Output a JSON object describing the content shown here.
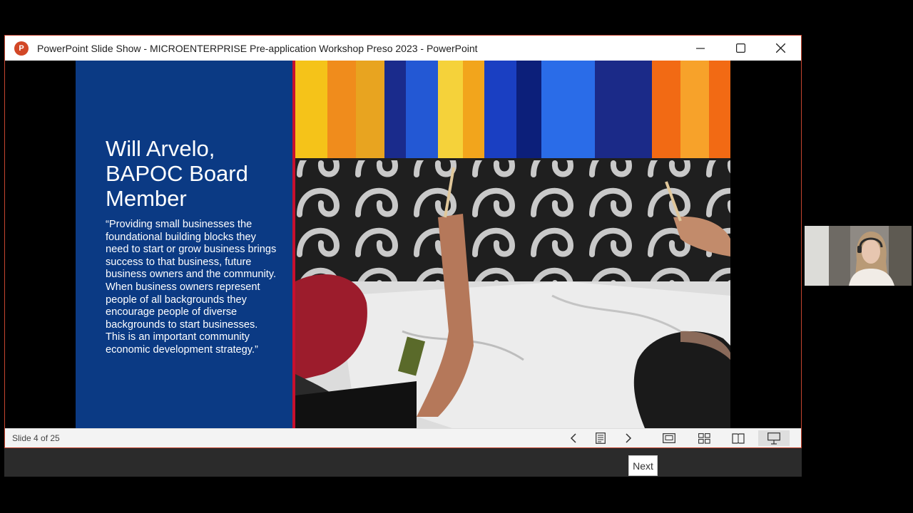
{
  "window": {
    "title": "PowerPoint Slide Show  -  MICROENTERPRISE Pre-application Workshop Preso 2023 - PowerPoint",
    "app_icon": "powerpoint-icon",
    "app_icon_letter": "P",
    "controls": [
      "minimize-icon",
      "maximize-icon",
      "close-icon"
    ],
    "border_color": "#c5452f"
  },
  "slide": {
    "heading": "Will Arvelo, BAPOC Board Member",
    "quote": "“Providing small businesses the foundational building blocks they need to start or grow business brings success to that business,  future business owners and the community. When business owners represent people of all backgrounds they encourage people of diverse backgrounds to start businesses. This is an important community economic development strategy.”",
    "panel_color": "#0b3a84",
    "accent_color": "#c8102e"
  },
  "statusbar": {
    "slide_counter": "Slide 4 of 25",
    "icons": [
      "previous-icon",
      "notes-icon",
      "next-icon",
      "normal-view-icon",
      "slide-sorter-icon",
      "reading-view-icon",
      "slide-show-icon"
    ]
  },
  "tooltip": {
    "text": "Next"
  },
  "participant": {
    "icon": "participant-video-icon"
  }
}
